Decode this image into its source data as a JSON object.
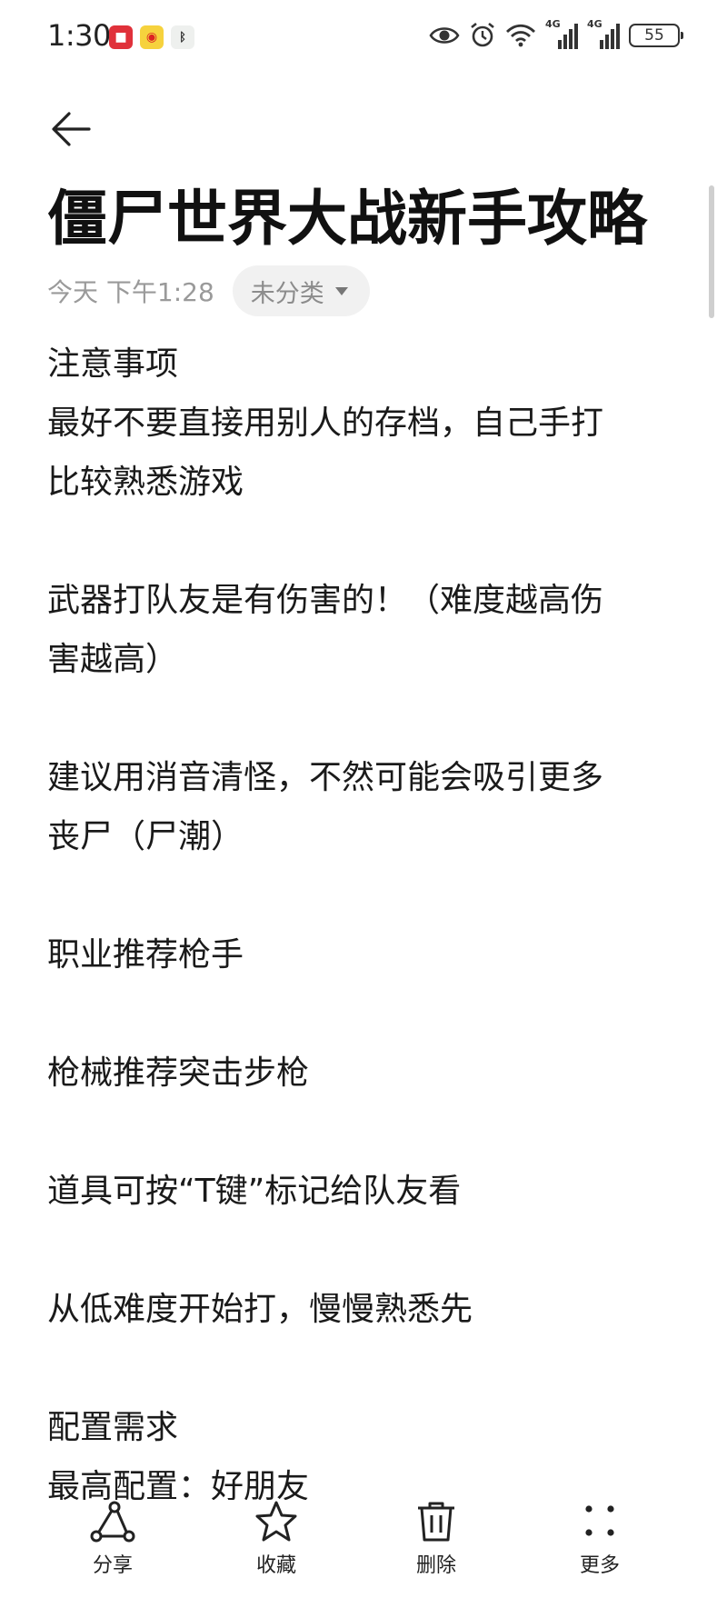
{
  "status_bar": {
    "time": "1:30",
    "network_label_1": "4G",
    "network_label_2": "4G",
    "battery": "55",
    "app_icons": [
      "red-app-icon",
      "weibo-icon",
      "bluetooth-app-icon"
    ]
  },
  "note": {
    "title": "僵尸世界大战新手攻略",
    "date": "今天 下午1:28",
    "category": "未分类",
    "lines": [
      "注意事项",
      "最好不要直接用别人的存档，自己手打",
      "比较熟悉游戏",
      "",
      "武器打队友是有伤害的！（难度越高伤",
      "害越高）",
      "",
      "建议用消音清怪，不然可能会吸引更多",
      "丧尸（尸潮）",
      "",
      "职业推荐枪手",
      "",
      "枪械推荐突击步枪",
      "",
      "道具可按“T键”标记给队友看",
      "",
      "从低难度开始打，慢慢熟悉先",
      "",
      "配置需求",
      "最高配置：好朋友"
    ]
  },
  "toolbar": {
    "share_label": "分享",
    "favorite_label": "收藏",
    "delete_label": "删除",
    "more_label": "更多"
  },
  "colors": {
    "text": "#111111",
    "meta": "#9a9a9a",
    "chip_bg": "#f1f1f1"
  }
}
